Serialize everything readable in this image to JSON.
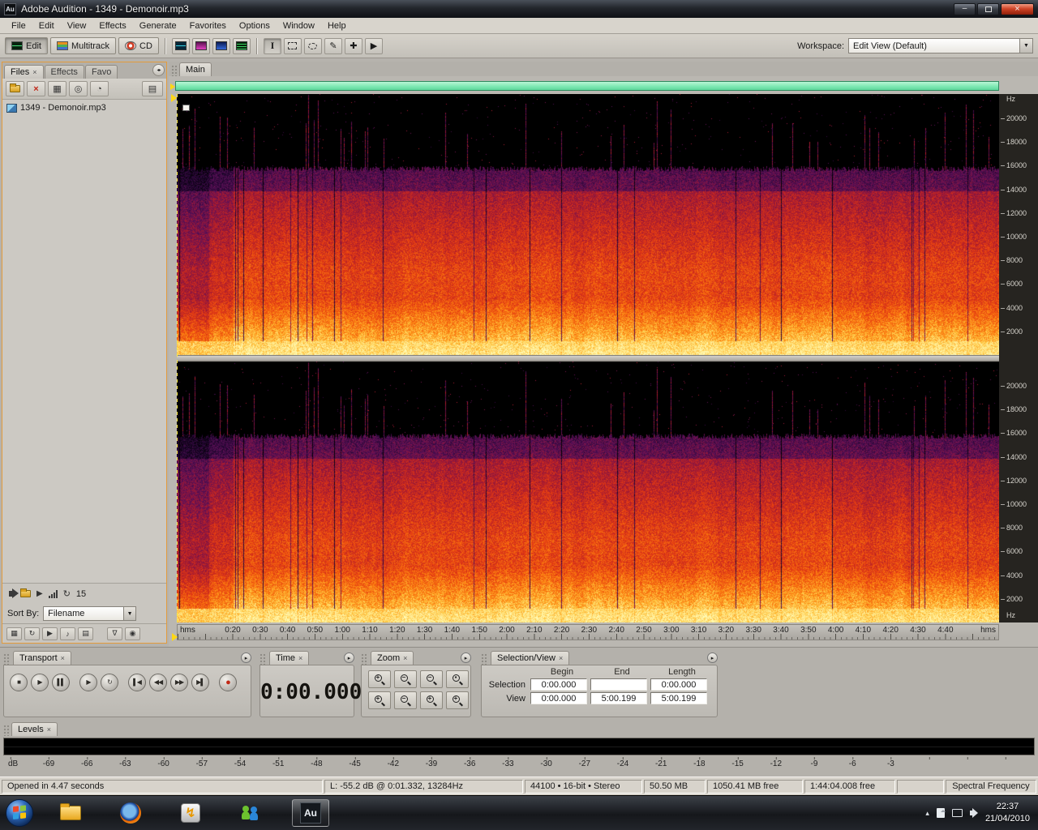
{
  "window": {
    "title": "Adobe Audition - 1349 - Demonoir.mp3",
    "app_badge": "Au"
  },
  "menu": {
    "items": [
      "File",
      "Edit",
      "View",
      "Effects",
      "Generate",
      "Favorites",
      "Options",
      "Window",
      "Help"
    ]
  },
  "toolbar": {
    "view_buttons": [
      {
        "label": "Edit"
      },
      {
        "label": "Multitrack"
      },
      {
        "label": "CD"
      }
    ],
    "workspace_label": "Workspace:",
    "workspace_value": "Edit View (Default)"
  },
  "files_panel": {
    "tabs": [
      {
        "label": "Files"
      },
      {
        "label": "Effects"
      },
      {
        "label": "Favo"
      }
    ],
    "files": [
      {
        "name": "1349 - Demonoir.mp3"
      }
    ],
    "preview_volume": "15",
    "sort_by_label": "Sort By:",
    "sort_by_value": "Filename"
  },
  "main_panel": {
    "tab_label": "Main",
    "freq_unit": "Hz",
    "freq_ticks": [
      20000,
      18000,
      16000,
      14000,
      12000,
      10000,
      8000,
      6000,
      4000,
      2000
    ],
    "time_unit": "hms",
    "time_ticks": [
      "0:20",
      "0:30",
      "0:40",
      "0:50",
      "1:00",
      "1:10",
      "1:20",
      "1:30",
      "1:40",
      "1:50",
      "2:00",
      "2:10",
      "2:20",
      "2:30",
      "2:40",
      "2:50",
      "3:00",
      "3:10",
      "3:20",
      "3:30",
      "3:40",
      "3:50",
      "4:00",
      "4:10",
      "4:20",
      "4:30",
      "4:40"
    ]
  },
  "transport": {
    "title": "Transport",
    "buttons": [
      {
        "name": "stop-button",
        "glyph": "■"
      },
      {
        "name": "play-button",
        "glyph": "▶"
      },
      {
        "name": "pause-button",
        "glyph": "▌▌"
      },
      {
        "name": "play-from-cursor-button",
        "glyph": "▶"
      },
      {
        "name": "play-looped-button",
        "glyph": "↻"
      },
      {
        "name": "go-to-beginning-button",
        "glyph": "▌◀"
      },
      {
        "name": "rewind-button",
        "glyph": "◀◀"
      },
      {
        "name": "fast-forward-button",
        "glyph": "▶▶"
      },
      {
        "name": "go-to-end-button",
        "glyph": "▶▌"
      },
      {
        "name": "record-button",
        "glyph": "●"
      }
    ]
  },
  "time_panel": {
    "title": "Time",
    "value": "0:00.000"
  },
  "zoom_panel": {
    "title": "Zoom",
    "buttons": [
      {
        "name": "zoom-in-horizontal-button",
        "sign": "+"
      },
      {
        "name": "zoom-out-horizontal-button",
        "sign": "−"
      },
      {
        "name": "zoom-out-full-button",
        "sign": "−"
      },
      {
        "name": "zoom-to-selection-button",
        "sign": "▪"
      },
      {
        "name": "zoom-in-vertical-button",
        "sign": "+"
      },
      {
        "name": "zoom-out-vertical-button",
        "sign": "−"
      },
      {
        "name": "zoom-left-edge-button",
        "sign": "+"
      },
      {
        "name": "zoom-right-edge-button",
        "sign": "+"
      }
    ]
  },
  "selection_panel": {
    "title": "Selection/View",
    "headers": [
      "Begin",
      "End",
      "Length"
    ],
    "rows": [
      {
        "label": "Selection",
        "begin": "0:00.000",
        "end": "",
        "length": "0:00.000"
      },
      {
        "label": "View",
        "begin": "0:00.000",
        "end": "5:00.199",
        "length": "5:00.199"
      }
    ]
  },
  "levels_panel": {
    "title": "Levels",
    "scale": [
      "dB",
      "-69",
      "-66",
      "-63",
      "-60",
      "-57",
      "-54",
      "-51",
      "-48",
      "-45",
      "-42",
      "-39",
      "-36",
      "-33",
      "-30",
      "-27",
      "-24",
      "-21",
      "-18",
      "-15",
      "-12",
      "-9",
      "-6",
      "-3"
    ]
  },
  "status_bar": {
    "segments": [
      "Opened in 4.47 seconds",
      "L: -55.2 dB @ 0:01.332, 13284Hz",
      "44100 • 16-bit • Stereo",
      "50.50 MB",
      "1050.41 MB free",
      "1:44:04.008 free",
      "",
      "Spectral Frequency"
    ]
  },
  "taskbar": {
    "clock_time": "22:37",
    "clock_date": "21/04/2010"
  },
  "icons": {
    "close": "×",
    "minimize": "–",
    "dropdown_arrow": "▼",
    "panel_menu": "▸",
    "tab_scroll": "◂▸",
    "ibeam": "I",
    "paintbrush": "✎",
    "heal": "✚",
    "scrub": "▶",
    "import_x": "×",
    "grid": "▦",
    "disc": "◎",
    "clockq": "◔",
    "rows": "▤",
    "play_small": "▶",
    "loop": "↻",
    "note": "♪",
    "funnel": "∇",
    "target": "◉",
    "chevron_up": "▴",
    "lightning": "↯"
  },
  "colors": {
    "focus_orange": "#e39b3c",
    "overview_green": "#7fe9b4",
    "record_red": "#c22a16"
  }
}
